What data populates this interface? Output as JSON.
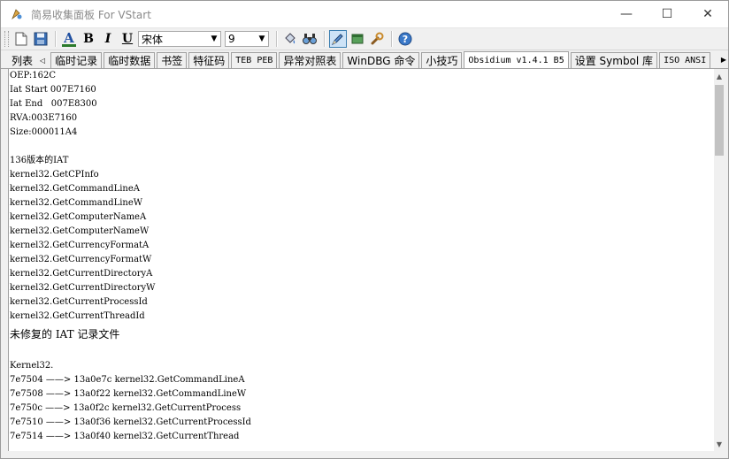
{
  "window": {
    "title": "简易收集面板 For VStart",
    "minimize_glyph": "—",
    "maximize_glyph": "☐",
    "close_glyph": "✕"
  },
  "toolbar": {
    "font_name": "宋体",
    "font_size": "9",
    "bold_label": "B",
    "italic_label": "I",
    "underline_label": "U",
    "font_color_label": "A",
    "font_color": "#2b7a2b",
    "icons": [
      "new-file-icon",
      "save-icon",
      "font-color-icon",
      "bold-icon",
      "italic-icon",
      "underline-icon",
      "fill-icon",
      "find-icon",
      "edit-icon",
      "window-icon",
      "tools-icon",
      "help-icon"
    ]
  },
  "tabs": {
    "first_label": "列表",
    "items": [
      {
        "label": "临时记录",
        "mono": false
      },
      {
        "label": "临时数据",
        "mono": false
      },
      {
        "label": "书签",
        "mono": false
      },
      {
        "label": "特征码",
        "mono": false
      },
      {
        "label": "TEB PEB",
        "mono": true
      },
      {
        "label": "异常对照表",
        "mono": false
      },
      {
        "label": "WinDBG 命令",
        "mono": false
      },
      {
        "label": "小技巧",
        "mono": false
      },
      {
        "label": "Obsidium v1.4.1 B5",
        "mono": true,
        "active": true
      },
      {
        "label": "设置 Symbol 库",
        "mono": false
      },
      {
        "label": "ISO ANSI",
        "mono": true
      }
    ]
  },
  "content": {
    "lines": [
      {
        "text": "OEP:162C"
      },
      {
        "text": "Iat Start 007E7160"
      },
      {
        "text": "Iat End   007E8300"
      },
      {
        "text": "RVA:003E7160"
      },
      {
        "text": "Size:000011A4"
      },
      {
        "text": ""
      },
      {
        "text": "136版本的IAT"
      },
      {
        "text": "kernel32.GetCPInfo"
      },
      {
        "text": "kernel32.GetCommandLineA"
      },
      {
        "text": "kernel32.GetCommandLineW"
      },
      {
        "text": "kernel32.GetComputerNameA"
      },
      {
        "text": "kernel32.GetComputerNameW"
      },
      {
        "text": "kernel32.GetCurrencyFormatA"
      },
      {
        "text": "kernel32.GetCurrencyFormatW"
      },
      {
        "text": "kernel32.GetCurrentDirectoryA"
      },
      {
        "text": "kernel32.GetCurrentDirectoryW"
      },
      {
        "text": "kernel32.GetCurrentProcessId"
      },
      {
        "text": "kernel32.GetCurrentThreadId"
      },
      {
        "text": "未修复的 IAT 记录文件",
        "big": true
      },
      {
        "text": ""
      },
      {
        "text": "Kernel32."
      },
      {
        "text": "7e7504 ——> 13a0e7c kernel32.GetCommandLineA"
      },
      {
        "text": "7e7508 ——> 13a0f22 kernel32.GetCommandLineW"
      },
      {
        "text": "7e750c ——> 13a0f2c kernel32.GetCurrentProcess"
      },
      {
        "text": "7e7510 ——> 13a0f36 kernel32.GetCurrentProcessId"
      },
      {
        "text": "7e7514 ——> 13a0f40 kernel32.GetCurrentThread"
      }
    ]
  }
}
